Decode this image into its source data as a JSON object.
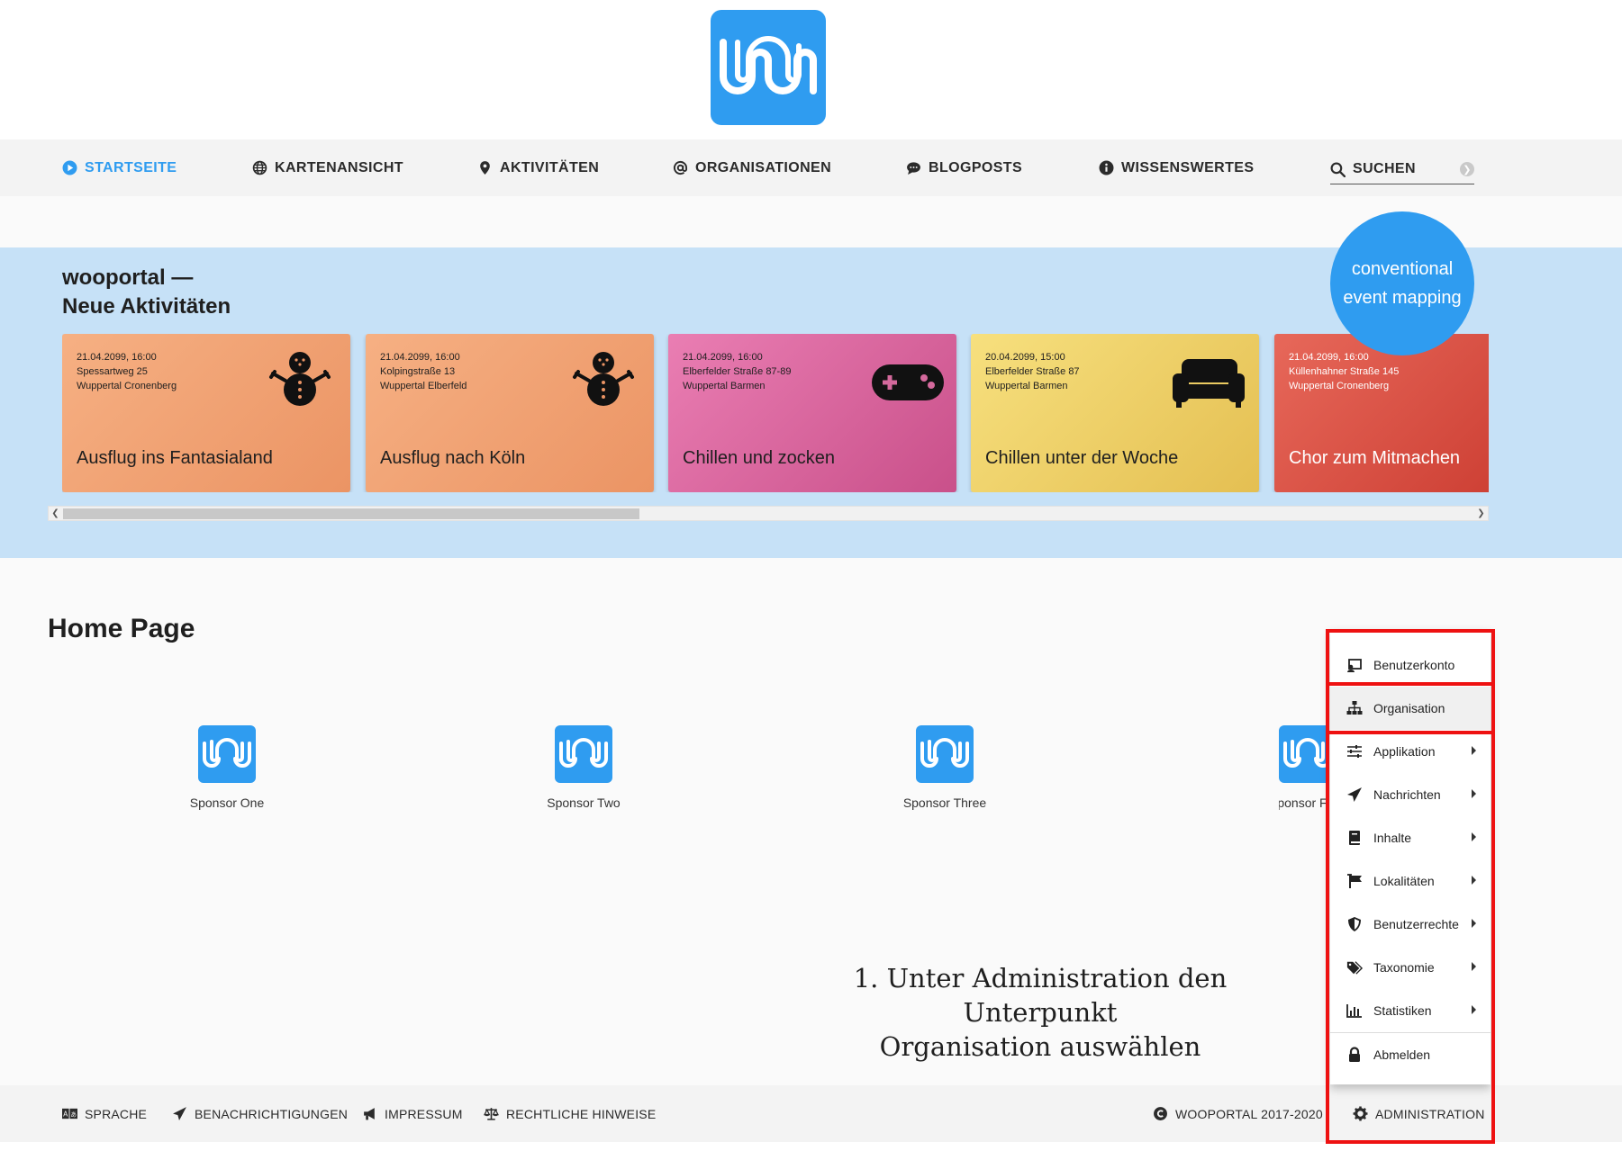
{
  "nav": {
    "items": [
      {
        "label": "STARTSEITE",
        "icon": "play-circle-icon",
        "active": true
      },
      {
        "label": "KARTENANSICHT",
        "icon": "globe-icon"
      },
      {
        "label": "AKTIVITÄTEN",
        "icon": "map-marker-icon"
      },
      {
        "label": "ORGANISATIONEN",
        "icon": "at-icon"
      },
      {
        "label": "BLOGPOSTS",
        "icon": "comments-icon"
      },
      {
        "label": "WISSENSWERTES",
        "icon": "info-circle-icon"
      }
    ],
    "search_label": "SUCHEN"
  },
  "band": {
    "title_line1": "wooportal —",
    "title_line2": "Neue Aktivitäten",
    "bubble_line1": "conventional",
    "bubble_line2": "event mapping"
  },
  "cards": [
    {
      "date": "21.04.2099, 16:00",
      "street": "Spessartweg 25",
      "district": "Wuppertal Cronenberg",
      "title": "Ausflug ins Fantasialand",
      "icon": "snowman-icon",
      "colors": [
        "#f6b083",
        "#eb9464"
      ]
    },
    {
      "date": "21.04.2099, 16:00",
      "street": "Kolpingstraße 13",
      "district": "Wuppertal Elberfeld",
      "title": "Ausflug nach Köln",
      "icon": "snowman-icon",
      "colors": [
        "#f6b083",
        "#eb9464"
      ]
    },
    {
      "date": "21.04.2099, 16:00",
      "street": "Elberfelder Straße 87-89",
      "district": "Wuppertal Barmen",
      "title": "Chillen und zocken",
      "icon": "gamepad-icon",
      "colors": [
        "#ea7eb3",
        "#c9508a"
      ]
    },
    {
      "date": "20.04.2099, 15:00",
      "street": "Elberfelder Straße 87",
      "district": "Wuppertal Barmen",
      "title": "Chillen unter der Woche",
      "icon": "couch-icon",
      "colors": [
        "#f7e07e",
        "#e4bf52"
      ]
    },
    {
      "date": "21.04.2099, 16:00",
      "street": "Küllenhahner Straße 145",
      "district": "Wuppertal Cronenberg",
      "title": "Chor zum Mitmachen",
      "icon": "none",
      "colors": [
        "#e7685a",
        "#c9392e"
      ]
    }
  ],
  "main": {
    "title": "Home Page",
    "sponsors": [
      "Sponsor One",
      "Sponsor Two",
      "Sponsor Three",
      "Sponsor Four"
    ],
    "note_line1": "1. Unter Administration den Unterpunkt",
    "note_line2": "Organisation auswählen"
  },
  "admin_menu": [
    {
      "label": "Benutzerkonto",
      "icon": "user-account-icon",
      "submenu": false
    },
    {
      "label": "Organisation",
      "icon": "sitemap-icon",
      "submenu": false,
      "hover": true
    },
    {
      "label": "Applikation",
      "icon": "sliders-icon",
      "submenu": true
    },
    {
      "label": "Nachrichten",
      "icon": "paper-plane-icon",
      "submenu": true
    },
    {
      "label": "Inhalte",
      "icon": "book-icon",
      "submenu": true
    },
    {
      "label": "Lokalitäten",
      "icon": "flag-icon",
      "submenu": true
    },
    {
      "label": "Benutzerrechte",
      "icon": "shield-icon",
      "submenu": true
    },
    {
      "label": "Taxonomie",
      "icon": "tags-icon",
      "submenu": true
    },
    {
      "label": "Statistiken",
      "icon": "chart-bar-icon",
      "submenu": true
    },
    {
      "label": "Abmelden",
      "icon": "lock-icon",
      "submenu": false
    }
  ],
  "footer": {
    "items": [
      {
        "label": "SPRACHE",
        "icon": "language-icon"
      },
      {
        "label": "BENACHRICHTIGUNGEN",
        "icon": "paper-plane-icon"
      },
      {
        "label": "IMPRESSUM",
        "icon": "bullhorn-icon"
      },
      {
        "label": "RECHTLICHE HINWEISE",
        "icon": "balance-scale-icon"
      }
    ],
    "copyright": "WOOPORTAL 2017-2020",
    "admin_label": "ADMINISTRATION"
  },
  "colors": {
    "brand": "#2f9cf0",
    "band_bg": "#c6e1f7",
    "highlight": "#ee1111"
  }
}
